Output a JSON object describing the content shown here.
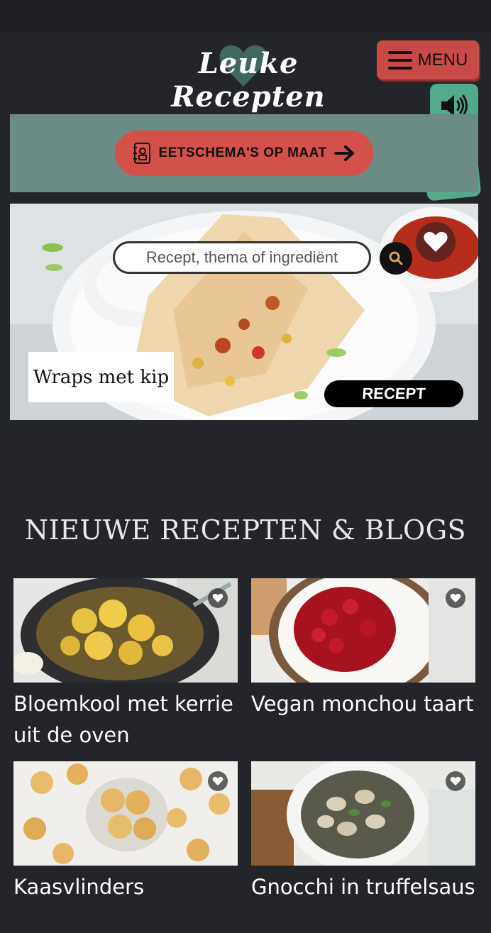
{
  "header": {
    "logo_text": "Leuke Recepten",
    "menu_label": "MENU"
  },
  "banner": {
    "eetschema_label": "EETSCHEMA'S OP MAAT"
  },
  "hero": {
    "search_placeholder": "Recept, thema of ingrediënt",
    "caption": "Wraps met kip",
    "recept_label": "RECEPT"
  },
  "section": {
    "title": "NIEUWE RECEPTEN & BLOGS"
  },
  "recipes": [
    {
      "title": "Bloemkool met kerrie uit de oven"
    },
    {
      "title": "Vegan monchou taart"
    },
    {
      "title": "Kaasvlinders"
    },
    {
      "title": "Gnocchi in truffelsaus"
    }
  ],
  "colors": {
    "background": "#24252a",
    "menu_button": "#c84a45",
    "sound_button": "#55a98b",
    "banner": "#6a8c84",
    "eetschema_button": "#d35149"
  },
  "icons": {
    "menu": "hamburger-icon",
    "sound": "speaker-icon",
    "christmas": "ornament-icon",
    "eetschema": "notebook-icon",
    "arrow": "arrow-right-icon",
    "search": "search-icon",
    "favorite": "heart-icon"
  }
}
